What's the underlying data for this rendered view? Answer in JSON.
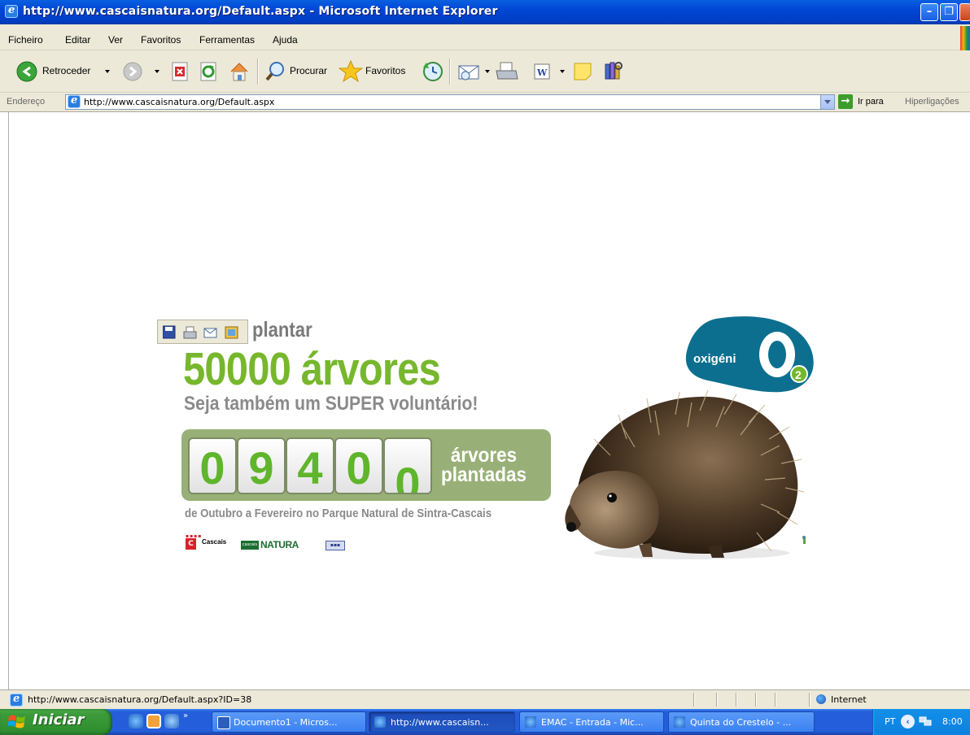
{
  "window": {
    "title": "http://www.cascaisnatura.org/Default.aspx - Microsoft Internet Explorer",
    "controls": [
      "minimize",
      "maximize",
      "close"
    ]
  },
  "menu": [
    "Ficheiro",
    "Editar",
    "Ver",
    "Favoritos",
    "Ferramentas",
    "Ajuda"
  ],
  "toolbar": {
    "back_label": "Retroceder",
    "search_label": "Procurar",
    "favorites_label": "Favoritos"
  },
  "address": {
    "label": "Endereço",
    "url": "http://www.cascaisnatura.org/Default.aspx",
    "go_label": "Ir para",
    "links_label": "Hiperligações"
  },
  "page": {
    "plantar": "plantar",
    "headline": "50000 árvores",
    "subline": "Seja também um SUPER voluntário!",
    "counter_digits": [
      "0",
      "9",
      "4",
      "0",
      "0"
    ],
    "counter_label_line1": "árvores",
    "counter_label_line2": "plantadas",
    "period": "de Outubro a Fevereiro no Parque Natural de Sintra-Cascais",
    "logo_cascais": "Cascais",
    "logo_cascais_letter": "C",
    "logo_natura": "NATURA",
    "logo_oxigenio": "oxigéni",
    "logo_colors": {
      "green": "#77b72d",
      "grey": "#8a8a8a",
      "counter_bg": "#98b077",
      "oxigenio_blue": "#0d6f8f",
      "oxigenio_green": "#74b72b"
    }
  },
  "status": {
    "text": "http://www.cascaisnatura.org/Default.aspx?ID=38",
    "zone": "Internet"
  },
  "taskbar": {
    "start_label": "Iniciar",
    "tasks": [
      {
        "label": "Documento1 - Micros...",
        "icon": "word-icon"
      },
      {
        "label": "http://www.cascaisn...",
        "icon": "ie-icon"
      },
      {
        "label": "EMAC - Entrada - Mic...",
        "icon": "ie-icon"
      },
      {
        "label": "Quinta do Crestelo - ...",
        "icon": "ie-icon"
      }
    ],
    "lang": "PT",
    "clock": "8:00"
  }
}
